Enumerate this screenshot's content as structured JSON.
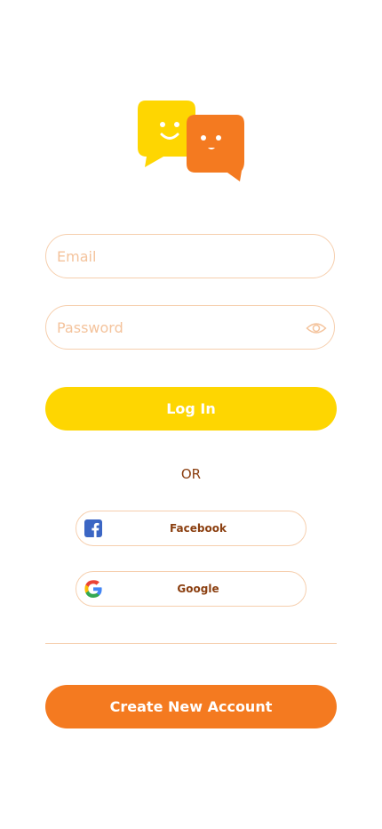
{
  "logo": {
    "icon": "chat-bubbles-logo",
    "colors": {
      "yellow": "#fed601",
      "orange": "#f47a20",
      "face": "#ffffff"
    }
  },
  "login_form": {
    "email": {
      "placeholder": "Email",
      "value": ""
    },
    "password": {
      "placeholder": "Password",
      "value": "",
      "toggle_icon": "eye-icon"
    },
    "login_label": "Log In"
  },
  "separator_text": "OR",
  "social": {
    "facebook_label": "Facebook",
    "google_label": "Google"
  },
  "create_account_label": "Create New Account",
  "colors": {
    "accent_yellow": "#fed601",
    "accent_orange": "#f47a20",
    "border": "#f6cfae",
    "text_brown": "#8b3f10"
  }
}
